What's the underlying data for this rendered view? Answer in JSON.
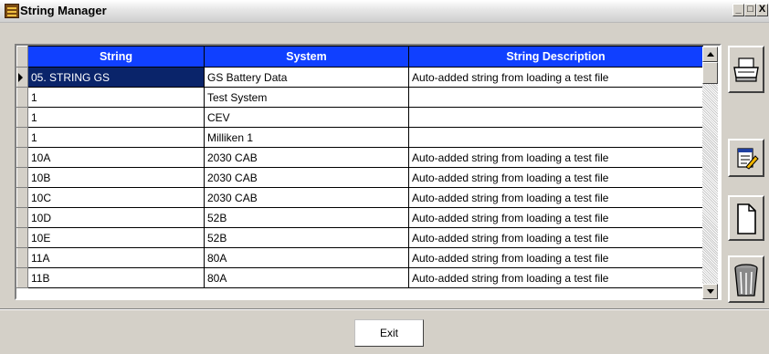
{
  "window": {
    "title": "String Manager",
    "controls": [
      "_",
      "□",
      "X"
    ]
  },
  "table": {
    "columns": [
      "String",
      "System",
      "String Description"
    ],
    "rows": [
      {
        "string": "05. STRING GS",
        "system": "GS Battery Data",
        "description": "Auto-added string from loading a test file",
        "selected": true
      },
      {
        "string": "1",
        "system": "Test System",
        "description": ""
      },
      {
        "string": "1",
        "system": "CEV",
        "description": ""
      },
      {
        "string": "1",
        "system": "Milliken 1",
        "description": ""
      },
      {
        "string": "10A",
        "system": "2030 CAB",
        "description": "Auto-added string from loading a test file"
      },
      {
        "string": "10B",
        "system": "2030 CAB",
        "description": "Auto-added string from loading a test file"
      },
      {
        "string": "10C",
        "system": "2030 CAB",
        "description": "Auto-added string from loading a test file"
      },
      {
        "string": "10D",
        "system": "52B",
        "description": "Auto-added string from loading a test file"
      },
      {
        "string": "10E",
        "system": "52B",
        "description": "Auto-added string from loading a test file"
      },
      {
        "string": "11A",
        "system": "80A",
        "description": "Auto-added string from loading a test file"
      },
      {
        "string": "11B",
        "system": "80A",
        "description": "Auto-added string from loading a test file"
      }
    ]
  },
  "toolbar": {
    "icons": [
      "printer-icon",
      "edit-document-icon",
      "new-document-icon",
      "trash-can-icon"
    ]
  },
  "footer": {
    "exit_label": "Exit"
  },
  "colors": {
    "header_bg": "#1040ff",
    "selection_bg": "#0a246a",
    "window_bg": "#d4d0c8"
  }
}
